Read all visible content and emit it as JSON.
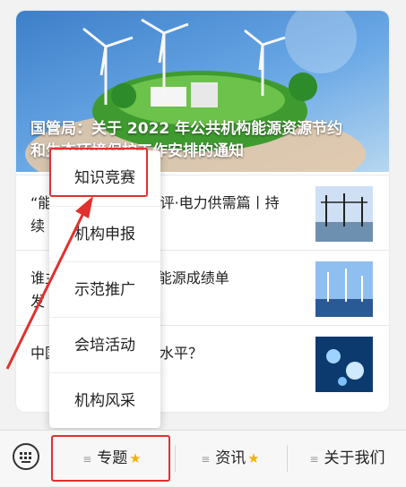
{
  "hero": {
    "title_line1": "国管局：关于 2022 年公共机构能源资源节约",
    "title_line2": "和生态环境保护工作安排的通知"
  },
  "articles": [
    {
      "text_line1": "“能源与环境保护”述评·电力供需篇丨持",
      "text_line2": "续"
    },
    {
      "text_line1": "谁主沉浮？2021 新能源成绩单",
      "text_line2": "发"
    },
    {
      "text_line1": "中国电量，在全球啥水平？",
      "text_line2": ""
    }
  ],
  "menu": {
    "items": [
      "知识竞赛",
      "机构申报",
      "示范推广",
      "会培活动",
      "机构风采"
    ]
  },
  "tabbar": {
    "tabs": [
      {
        "label": "专题",
        "has_star": true
      },
      {
        "label": "资讯",
        "has_star": true
      },
      {
        "label": "关于我们",
        "has_star": false
      }
    ]
  },
  "colors": {
    "annotation_red": "#e0312e",
    "star": "#f4b400"
  }
}
